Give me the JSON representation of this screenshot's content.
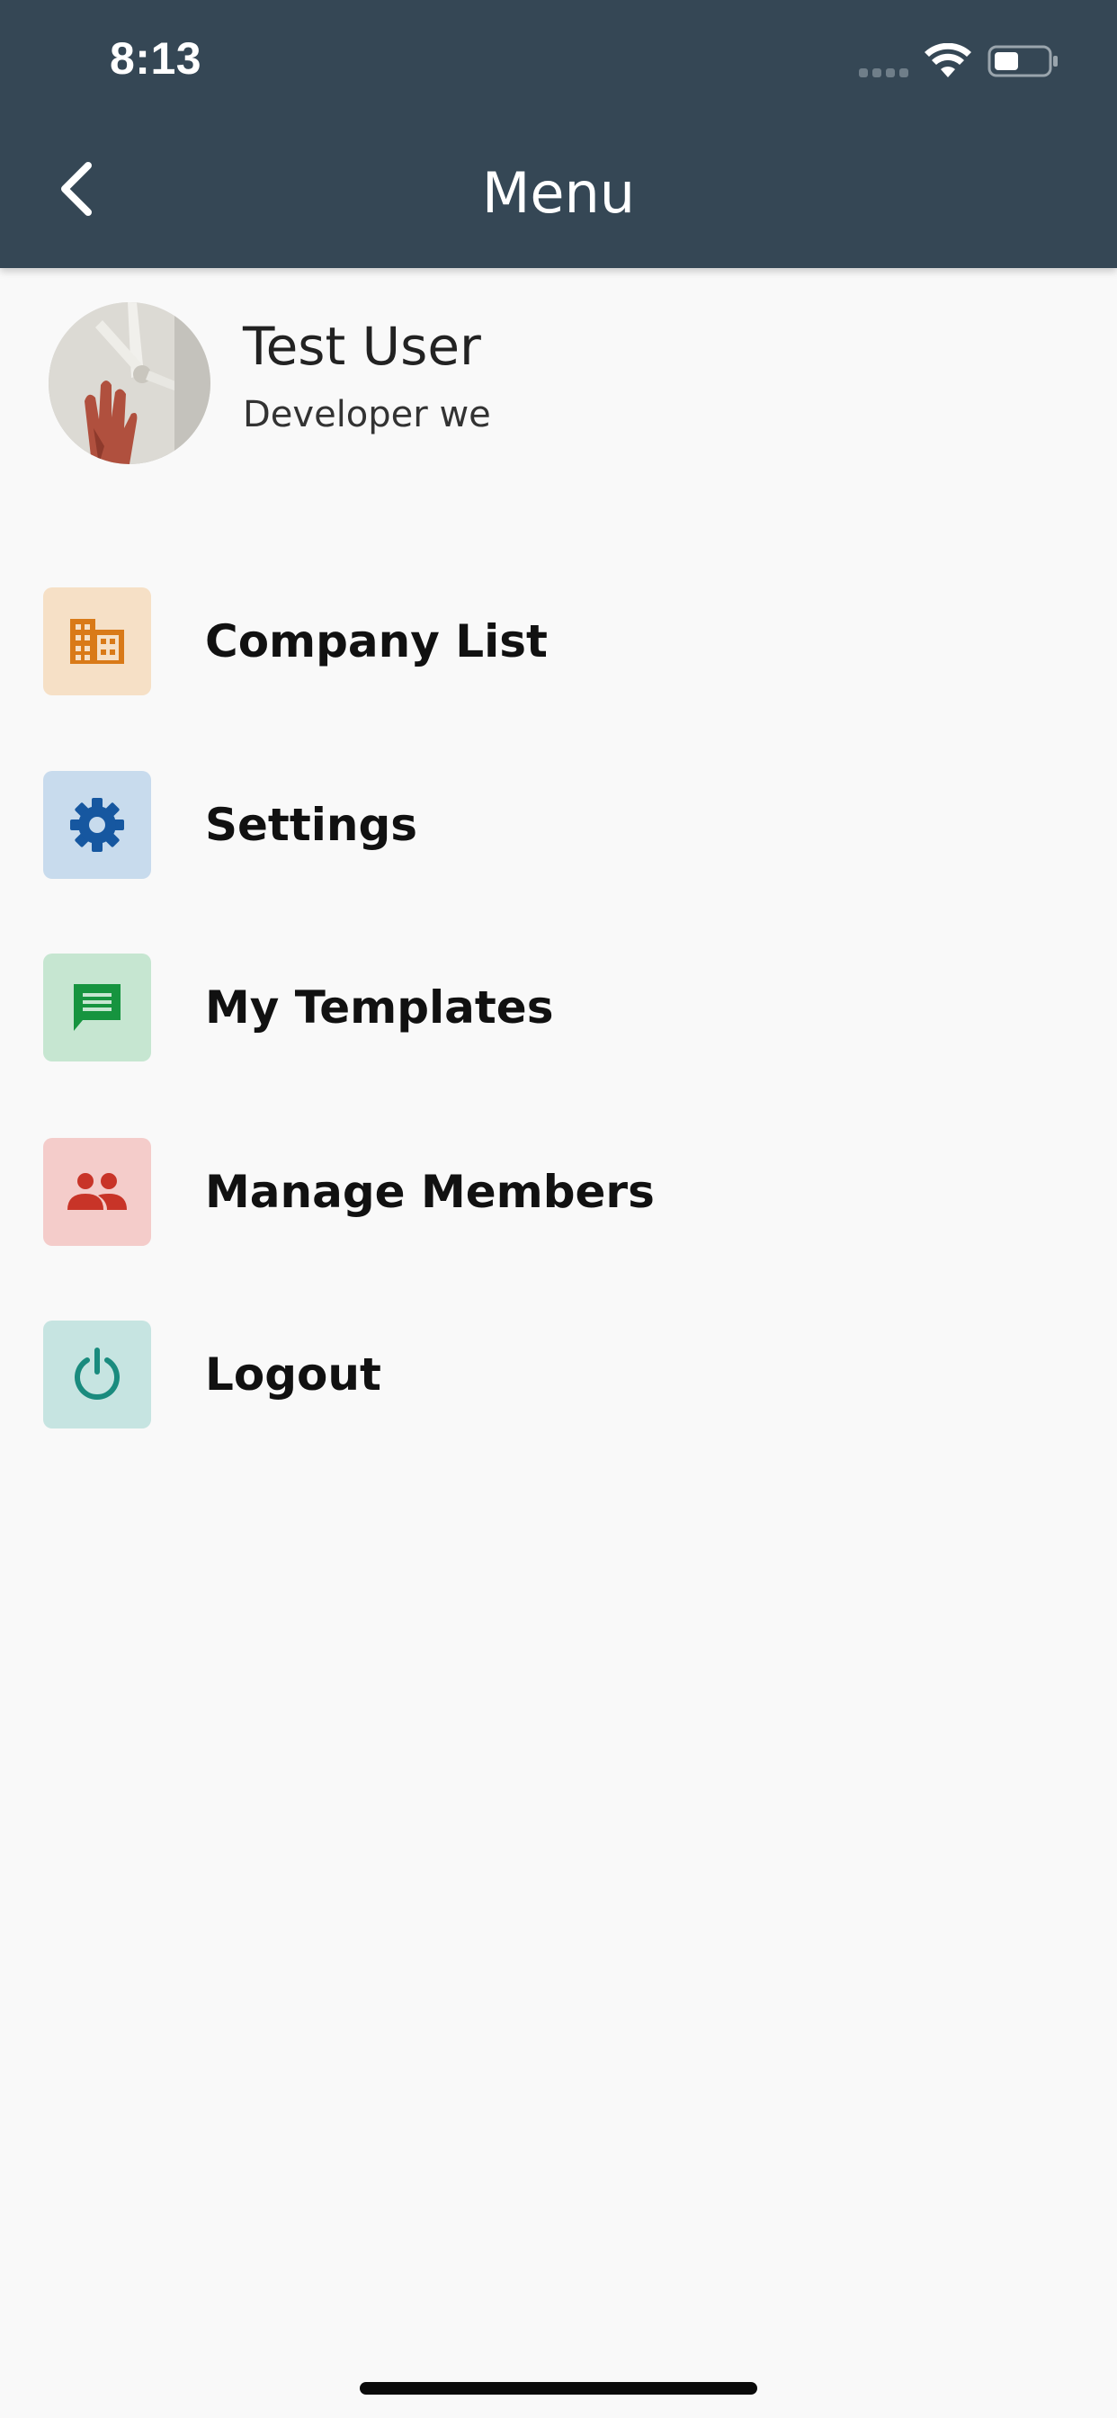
{
  "status_bar": {
    "time": "8:13"
  },
  "header": {
    "title": "Menu",
    "back_icon": "chevron-left-icon",
    "background": "#354755"
  },
  "profile": {
    "name": "Test User",
    "role": "Developer we"
  },
  "menu": {
    "items": [
      {
        "label": "Company List",
        "icon": "building-icon",
        "icon_color": "#d97a18",
        "bg_color": "#f6e0c6"
      },
      {
        "label": "Settings",
        "icon": "gear-icon",
        "icon_color": "#1657a0",
        "bg_color": "#c8dbed"
      },
      {
        "label": "My Templates",
        "icon": "message-icon",
        "icon_color": "#16943f",
        "bg_color": "#c6e6d1"
      },
      {
        "label": "Manage Members",
        "icon": "people-icon",
        "icon_color": "#c83428",
        "bg_color": "#f4ccca"
      },
      {
        "label": "Logout",
        "icon": "power-icon",
        "icon_color": "#1a8b7e",
        "bg_color": "#c6e4e1"
      }
    ]
  }
}
